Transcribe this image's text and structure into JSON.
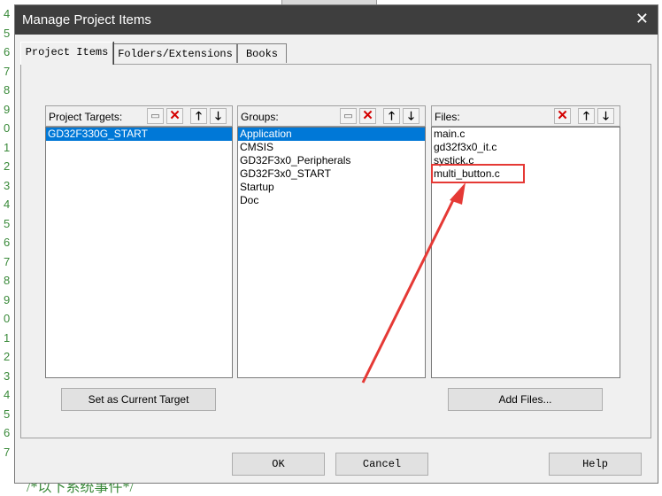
{
  "background": {
    "line_numbers": [
      "4",
      "5",
      "6",
      "7",
      "8",
      "9",
      "0",
      "1",
      "2",
      "3",
      "4",
      "5",
      "6",
      "7",
      "8",
      "9",
      "0",
      "1",
      "2",
      "3",
      "4",
      "5",
      "6",
      "7"
    ],
    "bottom_text": "/*以下系统事件*/"
  },
  "dialog": {
    "title": "Manage Project Items",
    "close_glyph": "✕",
    "tabs": [
      {
        "label": "Project Items",
        "active": true
      },
      {
        "label": "Folders/Extensions",
        "active": false
      },
      {
        "label": "Books",
        "active": false
      }
    ],
    "targets": {
      "label": "Project Targets:",
      "items": [
        "GD32F330G_START"
      ],
      "selected": 0,
      "button": "Set as Current Target"
    },
    "groups": {
      "label": "Groups:",
      "items": [
        "Application",
        "CMSIS",
        "GD32F3x0_Peripherals",
        "GD32F3x0_START",
        "Startup",
        "Doc"
      ],
      "selected": 0
    },
    "files": {
      "label": "Files:",
      "items": [
        "main.c",
        "gd32f3x0_it.c",
        "systick.c",
        "multi_button.c"
      ],
      "highlighted": 3,
      "button": "Add Files..."
    },
    "footer": {
      "ok": "OK",
      "cancel": "Cancel",
      "help": "Help"
    },
    "toolbar_icons": {
      "new": "▭",
      "delete": "✕",
      "up": "🡑",
      "down": "🡓"
    },
    "colors": {
      "titlebar": "#3e3e3e",
      "selection": "#0078d7",
      "annotation": "#e53935"
    }
  }
}
